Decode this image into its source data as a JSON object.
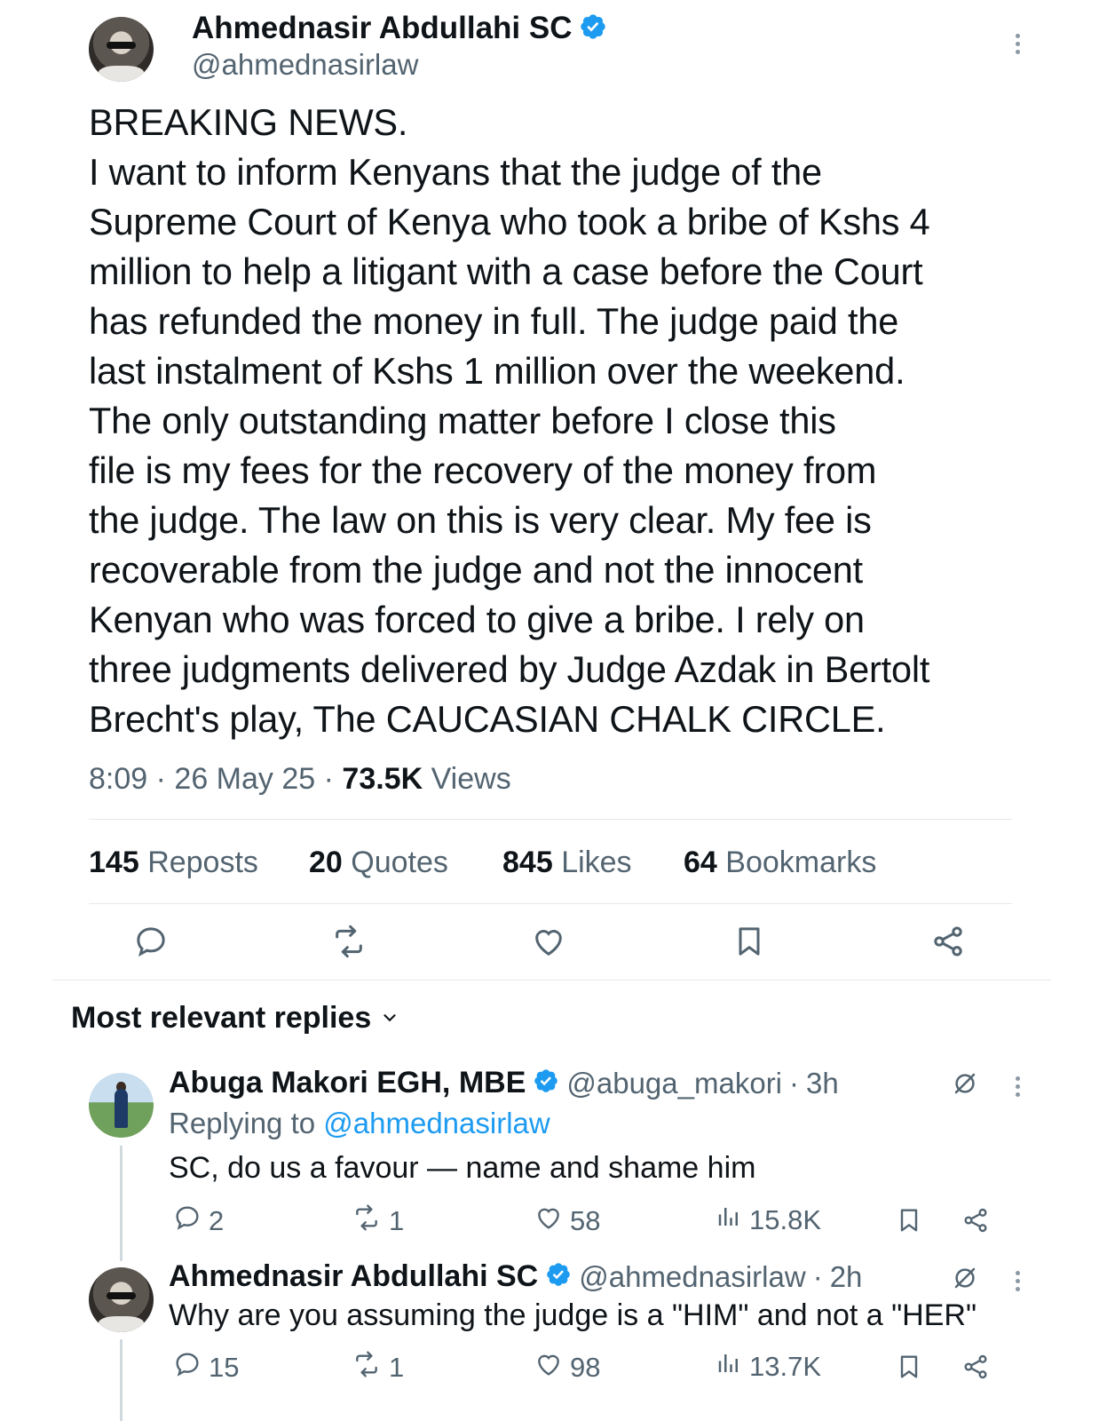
{
  "main_tweet": {
    "author_name": "Ahmednasir Abdullahi SC",
    "author_handle": "@ahmednasirlaw",
    "body": "BREAKING NEWS.\nI want to inform Kenyans that the judge of the\nSupreme Court of Kenya who took a bribe of Kshs 4\nmillion to help a litigant with a case before the Court\nhas refunded the money in full. The judge paid the\nlast instalment of Kshs 1 million over the weekend.\nThe only outstanding matter before I close this\nfile is my fees for the recovery of the money from\nthe judge. The law on this is very clear. My fee is\nrecoverable from the judge and not the innocent\nKenyan who was forced to give a bribe. I rely on\nthree judgments delivered by Judge Azdak in Bertolt\nBrecht's play, The CAUCASIAN CHALK CIRCLE.",
    "time": "8:09",
    "sep1": "·",
    "date": "26 May 25",
    "sep2": "·",
    "views_count": "73.5K",
    "views_label": "Views",
    "stats": {
      "reposts_count": "145",
      "reposts_label": "Reposts",
      "quotes_count": "20",
      "quotes_label": "Quotes",
      "likes_count": "845",
      "likes_label": "Likes",
      "bookmarks_count": "64",
      "bookmarks_label": "Bookmarks"
    }
  },
  "replies_section": {
    "title": "Most relevant replies",
    "chevron": "⌄"
  },
  "replies": [
    {
      "author_name": "Abuga Makori EGH, MBE",
      "author_handle": "@abuga_makori",
      "sep": "·",
      "age": "3h",
      "replying_prefix": "Replying to",
      "replying_to": "@ahmednasirlaw",
      "text": "SC, do us a favour — name and shame him",
      "replies": "2",
      "reposts": "1",
      "likes": "58",
      "views": "15.8K"
    },
    {
      "author_name": "Ahmednasir Abdullahi SC",
      "author_handle": "@ahmednasirlaw",
      "sep": "·",
      "age": "2h",
      "text": "Why are you assuming the judge is a \"HIM\" and not a \"HER\"",
      "replies": "15",
      "reposts": "1",
      "likes": "98",
      "views": "13.7K"
    }
  ],
  "colors": {
    "text": "#0f1419",
    "secondary": "#536471",
    "accent": "#1d9bf0",
    "divider": "#e6e9eb"
  },
  "icons": [
    "verified-badge-icon",
    "more-icon",
    "reply-icon",
    "repost-icon",
    "like-icon",
    "bookmark-icon",
    "share-icon",
    "views-icon",
    "grok-icon",
    "chevron-down-icon"
  ]
}
